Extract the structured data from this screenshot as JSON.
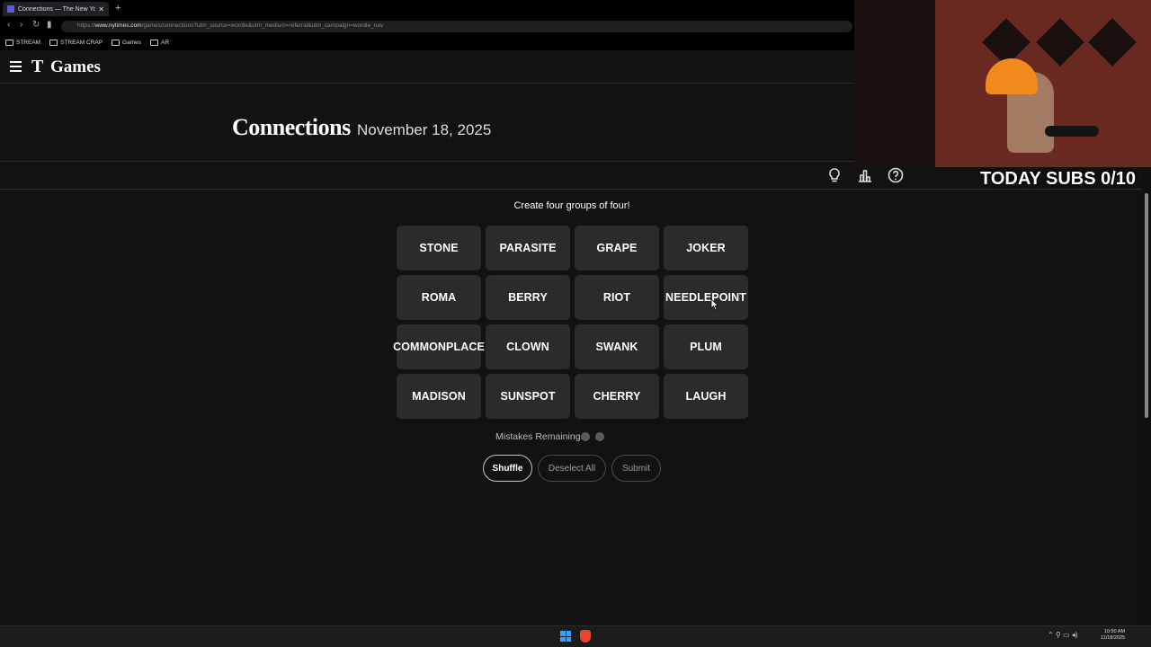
{
  "browser": {
    "tab_title": "Connections — The New York",
    "url_prefix": "https://",
    "url_domain": "www.nytimes.com",
    "url_path": "/games/connections?utm_source=wordle&utm_medium=referral&utm_campaign=wordle_nav",
    "bookmarks": [
      "STREAM",
      "STREAM CRAP",
      "Games",
      "AR"
    ]
  },
  "header": {
    "logo_mark": "T",
    "logo_text": "Games"
  },
  "game": {
    "title": "Connections",
    "date": "November 18, 2025",
    "instructions": "Create four groups of four!",
    "tiles": [
      "STONE",
      "PARASITE",
      "GRAPE",
      "JOKER",
      "ROMA",
      "BERRY",
      "RIOT",
      "NEEDLEPOINT",
      "COMMONPLACE",
      "CLOWN",
      "SWANK",
      "PLUM",
      "MADISON",
      "SUNSPOT",
      "CHERRY",
      "LAUGH"
    ],
    "mistakes_label": "Mistakes Remaining:",
    "mistakes_remaining": 2,
    "buttons": {
      "shuffle": "Shuffle",
      "deselect": "Deselect All",
      "submit": "Submit"
    }
  },
  "overlay": {
    "subs_text": "TODAY SUBS 0/10"
  },
  "taskbar": {
    "time": "10:50 AM",
    "date": "11/18/2025"
  },
  "colors": {
    "background": "#121213",
    "tile": "#2a2b2c",
    "accent_hat": "#f08a1c"
  }
}
